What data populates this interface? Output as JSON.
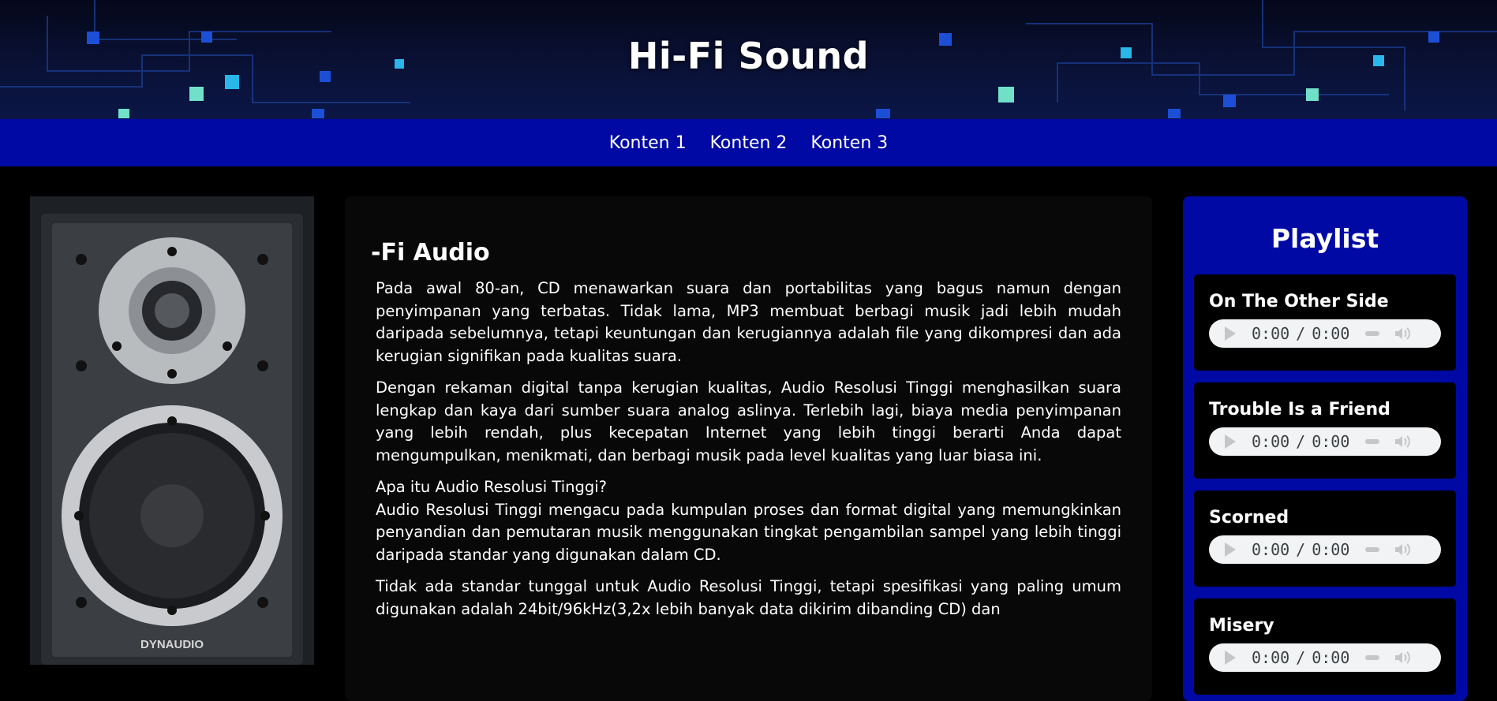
{
  "site": {
    "title": "Hi-Fi Sound"
  },
  "nav": {
    "items": [
      {
        "label": "Konten 1"
      },
      {
        "label": "Konten 2"
      },
      {
        "label": "Konten 3"
      }
    ]
  },
  "hero_image": {
    "brand": "DYNAUDIO"
  },
  "article": {
    "heading": "-Fi  Audio",
    "paragraphs": [
      "Pada awal 80-an, CD menawarkan suara dan portabilitas yang bagus namun dengan penyimpanan yang terbatas. Tidak lama, MP3 membuat berbagi musik jadi lebih mudah daripada sebelumnya, tetapi keuntungan dan kerugiannya adalah file yang dikompresi dan ada kerugian signifikan pada kualitas suara.",
      "Dengan rekaman digital tanpa kerugian kualitas, Audio Resolusi Tinggi menghasilkan suara lengkap dan kaya dari sumber suara analog aslinya. Terlebih lagi, biaya media penyimpanan yang lebih rendah, plus kecepatan Internet yang lebih tinggi berarti Anda dapat mengumpulkan, menikmati, dan berbagi musik pada level kualitas yang luar biasa ini.",
      "Apa itu Audio Resolusi Tinggi?",
      "Audio Resolusi Tinggi mengacu pada kumpulan proses dan format digital yang memungkinkan penyandian dan pemutaran musik menggunakan tingkat pengambilan sampel yang lebih tinggi daripada standar yang digunakan dalam CD.",
      "Tidak ada standar tunggal untuk Audio Resolusi Tinggi, tetapi spesifikasi yang paling umum digunakan adalah 24bit/96kHz(3,2x lebih banyak data dikirim dibanding CD) dan"
    ]
  },
  "playlist": {
    "title": "Playlist",
    "tracks": [
      {
        "title": "On The Other Side",
        "current": "0:00",
        "duration": "0:00"
      },
      {
        "title": "Trouble Is a Friend",
        "current": "0:00",
        "duration": "0:00"
      },
      {
        "title": "Scorned",
        "current": "0:00",
        "duration": "0:00"
      },
      {
        "title": "Misery",
        "current": "0:00",
        "duration": "0:00"
      }
    ]
  },
  "icons": {
    "play": "play-icon",
    "volume": "volume-icon"
  },
  "colors": {
    "nav_bg": "#0009a3",
    "playlist_bg": "#0009a3",
    "page_bg": "#000000",
    "player_bg": "#f1f3f4"
  }
}
